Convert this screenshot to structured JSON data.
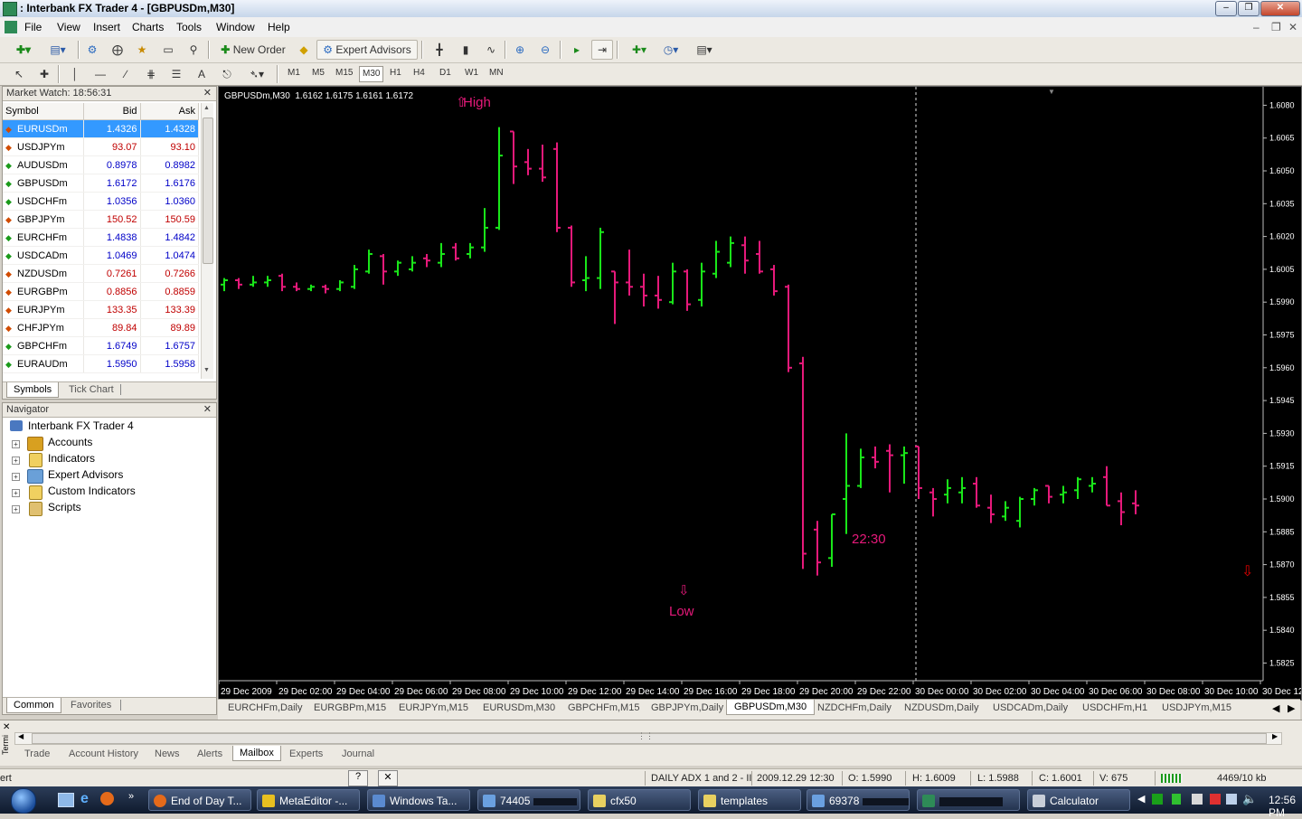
{
  "window": {
    "title": ": Interbank FX Trader 4 - [GBPUSDm,M30]",
    "controls": [
      "minimize-icon",
      "restore-icon",
      "close-icon"
    ]
  },
  "menu": [
    "File",
    "View",
    "Insert",
    "Charts",
    "Tools",
    "Window",
    "Help"
  ],
  "toolbar": {
    "new_order": "New Order",
    "expert_advisors": "Expert Advisors",
    "timeframes": [
      "M1",
      "M5",
      "M15",
      "M30",
      "H1",
      "H4",
      "D1",
      "W1",
      "MN"
    ],
    "selected_timeframe": "M30"
  },
  "market_watch": {
    "title": "Market Watch: 18:56:31",
    "columns": [
      "Symbol",
      "Bid",
      "Ask"
    ],
    "rows": [
      {
        "symbol": "EURUSDm",
        "bid": "1.4326",
        "ask": "1.4328",
        "dir": "down",
        "selected": true
      },
      {
        "symbol": "USDJPYm",
        "bid": "93.07",
        "ask": "93.10",
        "dir": "down"
      },
      {
        "symbol": "AUDUSDm",
        "bid": "0.8978",
        "ask": "0.8982",
        "dir": "up"
      },
      {
        "symbol": "GBPUSDm",
        "bid": "1.6172",
        "ask": "1.6176",
        "dir": "up"
      },
      {
        "symbol": "USDCHFm",
        "bid": "1.0356",
        "ask": "1.0360",
        "dir": "up"
      },
      {
        "symbol": "GBPJPYm",
        "bid": "150.52",
        "ask": "150.59",
        "dir": "down"
      },
      {
        "symbol": "EURCHFm",
        "bid": "1.4838",
        "ask": "1.4842",
        "dir": "up"
      },
      {
        "symbol": "USDCADm",
        "bid": "1.0469",
        "ask": "1.0474",
        "dir": "up"
      },
      {
        "symbol": "NZDUSDm",
        "bid": "0.7261",
        "ask": "0.7266",
        "dir": "down"
      },
      {
        "symbol": "EURGBPm",
        "bid": "0.8856",
        "ask": "0.8859",
        "dir": "down"
      },
      {
        "symbol": "EURJPYm",
        "bid": "133.35",
        "ask": "133.39",
        "dir": "down"
      },
      {
        "symbol": "CHFJPYm",
        "bid": "89.84",
        "ask": "89.89",
        "dir": "down"
      },
      {
        "symbol": "GBPCHFm",
        "bid": "1.6749",
        "ask": "1.6757",
        "dir": "up"
      },
      {
        "symbol": "EURAUDm",
        "bid": "1.5950",
        "ask": "1.5958",
        "dir": "up"
      }
    ],
    "tabs": [
      "Symbols",
      "Tick Chart"
    ]
  },
  "navigator": {
    "title": "Navigator",
    "root": "Interbank FX Trader 4",
    "items": [
      "Accounts",
      "Indicators",
      "Expert Advisors",
      "Custom Indicators",
      "Scripts"
    ],
    "tabs": [
      "Common",
      "Favorites"
    ]
  },
  "chart": {
    "header": "GBPUSDm,M30  1.6162 1.6175 1.6161 1.6172",
    "labels": {
      "high": "High",
      "low": "Low",
      "time": "22:30"
    },
    "colors": {
      "bull": "#19e619",
      "bear": "#e6197a",
      "label": "#e6197a",
      "background": "#000000",
      "arrow_red": "#e00000"
    },
    "tabs": [
      "EURCHFm,Daily",
      "EURGBPm,M15",
      "EURJPYm,M15",
      "EURUSDm,M30",
      "GBPCHFm,M15",
      "GBPJPYm,Daily",
      "GBPUSDm,M30",
      "NZDCHFm,Daily",
      "NZDUSDm,Daily",
      "USDCADm,Daily",
      "USDCHFm,H1",
      "USDJPYm,M15"
    ],
    "active_tab": "GBPUSDm,M30"
  },
  "chart_data": {
    "type": "ohlc",
    "title": "GBPUSDm,M30",
    "y_ticks": [
      "1.6080",
      "1.6065",
      "1.6050",
      "1.6035",
      "1.6020",
      "1.6005",
      "1.5990",
      "1.5975",
      "1.5960",
      "1.5945",
      "1.5930",
      "1.5915",
      "1.5900",
      "1.5885",
      "1.5870",
      "1.5855",
      "1.5840",
      "1.5825"
    ],
    "ylim": [
      1.5819,
      1.6081
    ],
    "x_ticks": [
      "29 Dec 2009",
      "29 Dec 02:00",
      "29 Dec 04:00",
      "29 Dec 06:00",
      "29 Dec 08:00",
      "29 Dec 10:00",
      "29 Dec 12:00",
      "29 Dec 14:00",
      "29 Dec 16:00",
      "29 Dec 18:00",
      "29 Dec 20:00",
      "29 Dec 22:00",
      "30 Dec 00:00",
      "30 Dec 02:00",
      "30 Dec 04:00",
      "30 Dec 06:00",
      "30 Dec 08:00",
      "30 Dec 10:00",
      "30 Dec 12"
    ],
    "bars_per_tick": 4,
    "candles": [
      [
        1.5998,
        1.6001,
        1.5995,
        1.6
      ],
      [
        1.6,
        1.6001,
        1.5996,
        1.5998
      ],
      [
        1.5998,
        1.6002,
        1.5997,
        1.5999
      ],
      [
        1.5999,
        1.6002,
        1.5997,
        1.6
      ],
      [
        1.6002,
        1.6003,
        1.5995,
        1.5997
      ],
      [
        1.5997,
        1.5999,
        1.5995,
        1.5996
      ],
      [
        1.5996,
        1.5998,
        1.5995,
        1.5997
      ],
      [
        1.5997,
        1.5998,
        1.5994,
        1.5996
      ],
      [
        1.5996,
        1.6,
        1.5995,
        1.5999
      ],
      [
        1.5997,
        1.6007,
        1.5996,
        1.6005
      ],
      [
        1.6004,
        1.6014,
        1.6003,
        1.6012
      ],
      [
        1.6011,
        1.6012,
        1.5998,
        1.6004
      ],
      [
        1.6004,
        1.6009,
        1.6002,
        1.6008
      ],
      [
        1.6005,
        1.6011,
        1.6004,
        1.6008
      ],
      [
        1.601,
        1.6012,
        1.6006,
        1.6009
      ],
      [
        1.6008,
        1.6017,
        1.6006,
        1.6012
      ],
      [
        1.6015,
        1.6017,
        1.6009,
        1.601
      ],
      [
        1.6012,
        1.6017,
        1.601,
        1.6015
      ],
      [
        1.6015,
        1.6033,
        1.6013,
        1.6024
      ],
      [
        1.6024,
        1.607,
        1.6023,
        1.6057
      ],
      [
        1.6068,
        1.6068,
        1.6044,
        1.6052
      ],
      [
        1.6054,
        1.606,
        1.6048,
        1.6051
      ],
      [
        1.6051,
        1.6062,
        1.6045,
        1.6047
      ],
      [
        1.606,
        1.6063,
        1.6022,
        1.6024
      ],
      [
        1.6024,
        1.6025,
        1.5997,
        1.5999
      ],
      [
        1.6,
        1.6011,
        1.5995,
        1.6001
      ],
      [
        1.6001,
        1.6024,
        1.5996,
        1.6022
      ],
      [
        1.6004,
        1.6004,
        1.598,
        1.5999
      ],
      [
        1.5999,
        1.6014,
        1.5993,
        1.5997
      ],
      [
        1.5997,
        1.6003,
        1.5988,
        1.5993
      ],
      [
        1.5993,
        1.6002,
        1.5987,
        1.5991
      ],
      [
        1.599,
        1.6008,
        1.5989,
        1.6004
      ],
      [
        1.6004,
        1.6005,
        1.5986,
        1.5989
      ],
      [
        1.5991,
        1.6008,
        1.5988,
        1.6004
      ],
      [
        1.6003,
        1.6018,
        1.6001,
        1.6013
      ],
      [
        1.6008,
        1.602,
        1.6006,
        1.6017
      ],
      [
        1.6016,
        1.602,
        1.6003,
        1.6009
      ],
      [
        1.6012,
        1.6018,
        1.6003,
        1.6004
      ],
      [
        1.6005,
        1.6007,
        1.5993,
        1.5995
      ],
      [
        1.5997,
        1.5998,
        1.5958,
        1.596
      ],
      [
        1.5962,
        1.5965,
        1.5868,
        1.5875
      ],
      [
        1.5886,
        1.589,
        1.5865,
        1.5871
      ],
      [
        1.5873,
        1.5893,
        1.5869,
        1.5893
      ],
      [
        1.59,
        1.593,
        1.5884,
        1.5906
      ],
      [
        1.5906,
        1.5923,
        1.5905,
        1.5919
      ],
      [
        1.5919,
        1.5924,
        1.5914,
        1.5917
      ],
      [
        1.5922,
        1.5925,
        1.5903,
        1.592
      ],
      [
        1.592,
        1.5924,
        1.5907,
        1.5921
      ],
      [
        1.5924,
        1.5924,
        1.59,
        1.5905
      ],
      [
        1.5903,
        1.5905,
        1.5892,
        1.59
      ],
      [
        1.5902,
        1.5909,
        1.5898,
        1.5905
      ],
      [
        1.5903,
        1.591,
        1.5898,
        1.5905
      ],
      [
        1.5907,
        1.591,
        1.5896,
        1.5897
      ],
      [
        1.5896,
        1.5902,
        1.5889,
        1.5893
      ],
      [
        1.5892,
        1.5899,
        1.589,
        1.5896
      ],
      [
        1.589,
        1.5901,
        1.5887,
        1.59
      ],
      [
        1.59,
        1.5905,
        1.5897,
        1.5904
      ],
      [
        1.5906,
        1.5906,
        1.5898,
        1.5901
      ],
      [
        1.5902,
        1.5906,
        1.5898,
        1.5903
      ],
      [
        1.5904,
        1.591,
        1.59,
        1.5909
      ],
      [
        1.5906,
        1.591,
        1.5903,
        1.5907
      ],
      [
        1.591,
        1.5915,
        1.5897,
        1.5897
      ],
      [
        1.5899,
        1.5903,
        1.5888,
        1.5894
      ],
      [
        1.5898,
        1.5904,
        1.5893,
        1.5897
      ]
    ]
  },
  "terminal": {
    "tabs": [
      "Trade",
      "Account History",
      "News",
      "Alerts",
      "Mailbox",
      "Experts",
      "Journal"
    ],
    "active_tab": "Mailbox",
    "side_label": "Termi"
  },
  "status": {
    "left": "ert",
    "template": "DAILY ADX 1 and 2 - II",
    "datetime": "2009.12.29 12:30",
    "open": "O: 1.5990",
    "high": "H: 1.6009",
    "low": "L: 1.5988",
    "close": "C: 1.6001",
    "volume": "V: 675",
    "traffic": "4469/10 kb"
  },
  "taskbar": {
    "items": [
      "End of Day T...",
      "MetaEditor -...",
      "Windows Ta...",
      "74405",
      "cfx50",
      "templates",
      "69378",
      "",
      "Calculator"
    ],
    "clock": "12:56 PM"
  }
}
